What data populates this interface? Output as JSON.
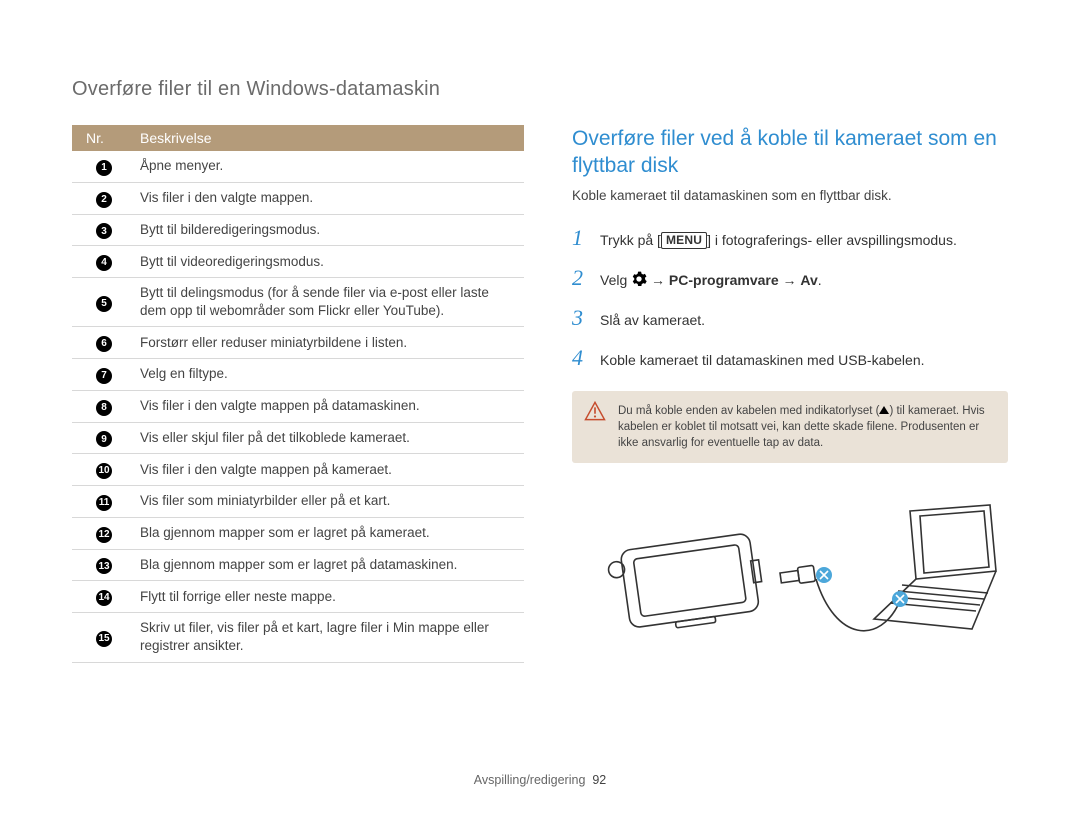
{
  "header": "Overføre filer til en Windows-datamaskin",
  "table": {
    "head_nr": "Nr.",
    "head_desc": "Beskrivelse",
    "rows": [
      "Åpne menyer.",
      "Vis filer i den valgte mappen.",
      "Bytt til bilderedigeringsmodus.",
      "Bytt til videoredigeringsmodus.",
      "Bytt til delingsmodus (for å sende filer via e-post eller laste dem opp til webområder som Flickr eller YouTube).",
      "Forstørr eller reduser miniatyrbildene i listen.",
      "Velg en filtype.",
      "Vis filer i den valgte mappen på datamaskinen.",
      "Vis eller skjul filer på det tilkoblede kameraet.",
      "Vis filer i den valgte mappen på kameraet.",
      "Vis filer som miniatyrbilder eller på et kart.",
      "Bla gjennom mapper som er lagret på kameraet.",
      "Bla gjennom mapper som er lagret på datamaskinen.",
      "Flytt til forrige eller neste mappe.",
      "Skriv ut filer, vis filer på et kart, lagre filer i Min mappe eller registrer ansikter."
    ]
  },
  "right": {
    "title": "Overføre filer ved å koble til kameraet som en flyttbar disk",
    "intro": "Koble kameraet til datamaskinen som en flyttbar disk.",
    "steps": {
      "s1_a": "Trykk på [",
      "s1_menu": "MENU",
      "s1_b": "] i fotograferings- eller avspillingsmodus.",
      "s2_a": "Velg ",
      "s2_b": " → ",
      "s2_bold1": "PC-programvare",
      "s2_c": " → ",
      "s2_bold2": "Av",
      "s2_d": ".",
      "s3": "Slå av kameraet.",
      "s4": "Koble kameraet til datamaskinen med USB-kabelen."
    },
    "note_a": "Du må koble enden av kabelen med indikatorlyset (",
    "note_b": ") til kameraet. Hvis kabelen er koblet til motsatt vei, kan dette skade filene. Produsenten er ikke ansvarlig for eventuelle tap av data."
  },
  "footer": {
    "section": "Avspilling/redigering",
    "page": "92"
  }
}
